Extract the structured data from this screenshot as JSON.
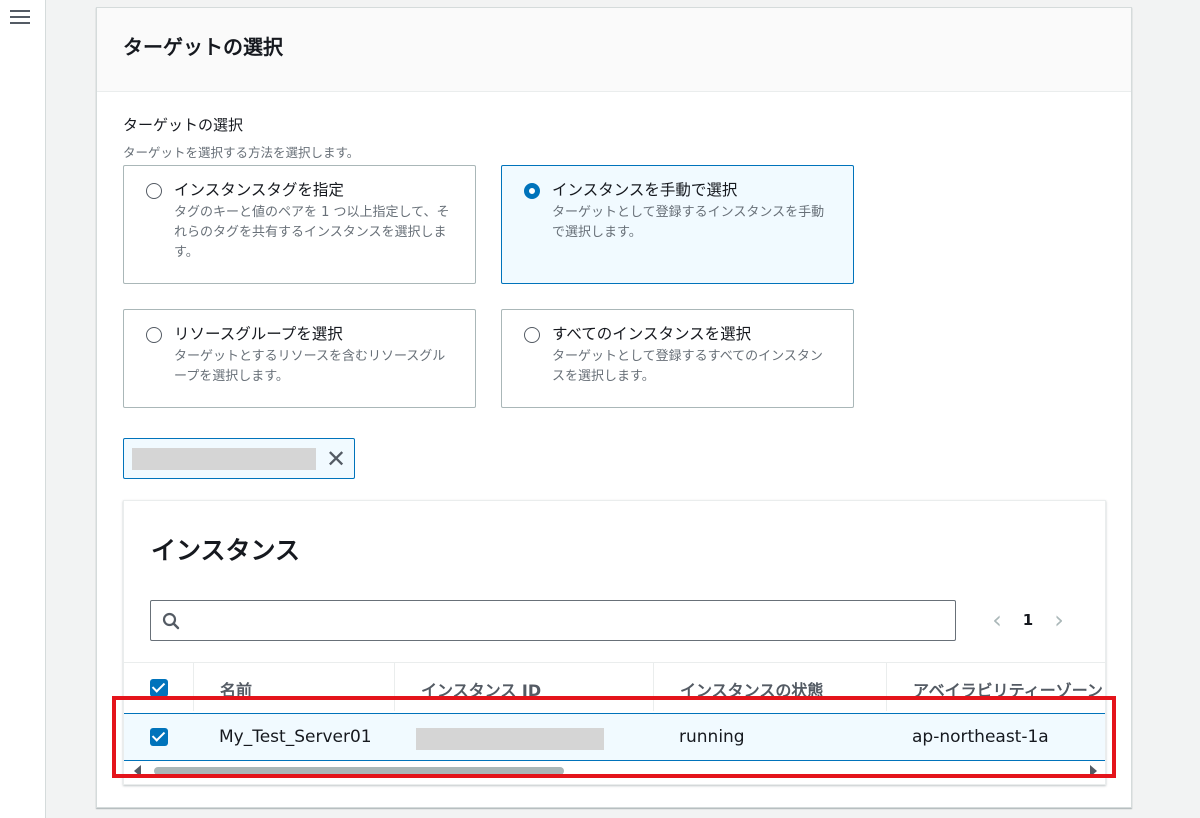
{
  "panel": {
    "title": "ターゲットの選択"
  },
  "selection": {
    "label": "ターゲットの選択",
    "description": "ターゲットを選択する方法を選択します。",
    "options": [
      {
        "title": "インスタンスタグを指定",
        "description": "タグのキーと値のペアを 1 つ以上指定して、それらのタグを共有するインスタンスを選択します。",
        "selected": false
      },
      {
        "title": "インスタンスを手動で選択",
        "description": "ターゲットとして登録するインスタンスを手動で選択します。",
        "selected": true
      },
      {
        "title": "リソースグループを選択",
        "description": "ターゲットとするリソースを含むリソースグループを選択します。",
        "selected": false
      },
      {
        "title": "すべてのインスタンスを選択",
        "description": "ターゲットとして登録するすべてのインスタンスを選択します。",
        "selected": false
      }
    ]
  },
  "token": {
    "close_glyph": "✕"
  },
  "instances": {
    "title": "インスタンス",
    "search_placeholder": "",
    "pagination": {
      "prev": "‹",
      "page": "1",
      "next": "›"
    },
    "columns": [
      "名前",
      "インスタンス ID",
      "インスタンスの状態",
      "アベイラビリティーゾーン"
    ],
    "rows": [
      {
        "name": "My_Test_Server01",
        "instance_state": "running",
        "availability_zone": "ap-northeast-1a",
        "selected": true
      }
    ]
  },
  "colors": {
    "accent": "#0073bb",
    "selected_background": "#f1faff",
    "highlight": "#e4141b"
  },
  "icons": {
    "menu": "hamburger-menu-icon",
    "search": "search-icon",
    "close": "close-icon"
  }
}
